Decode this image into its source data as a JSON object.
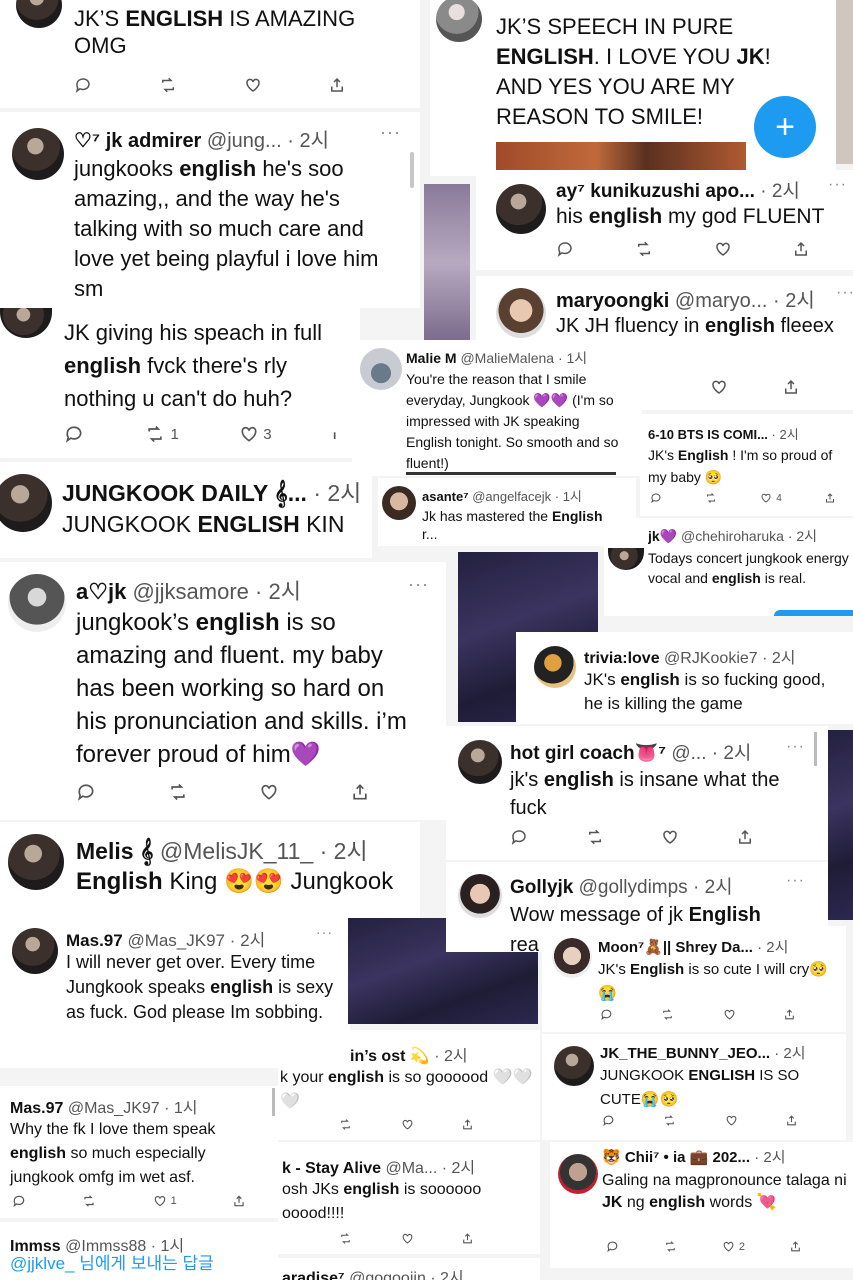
{
  "colors": {
    "accent": "#1d9bf0",
    "heart_purple": "#9b3de6",
    "text": "#111111",
    "muted": "#555555"
  },
  "tweets": [
    {
      "id": "t1",
      "text_pre": "JK’S ",
      "bold": "ENGLISH",
      "text_post": " IS AMAZING OMG"
    },
    {
      "id": "t2",
      "name": "♡⁷ jk admirer",
      "handle": "@jung... · 2시",
      "text_pre": "jungkooks ",
      "bold": "english",
      "text_post": " he's soo amazing,, and the way he's talking with so much care and love yet being playful i love him sm"
    },
    {
      "id": "t3",
      "text_pre": "JK giving his speach in full ",
      "bold": "english",
      "text_post": " fvck there's rly nothing u can't do huh?",
      "reply_count": "1",
      "like_count": "3"
    },
    {
      "id": "t4",
      "name": "JUNGKOOK DAILY 𝄞...",
      "handle": "· 2시",
      "text_pre": "JUNGKOOK ",
      "bold": "ENGLISH",
      "text_post": " KIN"
    },
    {
      "id": "t5",
      "name": "a♡jk",
      "handle": "@jjksamore · 2시",
      "text_pre": "jungkook’s ",
      "bold": "english",
      "text_post": " is so amazing and fluent. my baby has been working so hard on his pronunciation and skills. i’m forever proud of him💜"
    },
    {
      "id": "t6",
      "name": "Melis 𝄞",
      "handle": "@MelisJK_11_ · 2시",
      "text_pre": "",
      "bold": "English",
      "text_post": " King 😍😍 Jungkook"
    },
    {
      "id": "t7",
      "name": "Mas.97",
      "handle": "@Mas_JK97 · 2시",
      "text_pre": "I will never get over. Every time Jungkook speaks ",
      "bold": "english",
      "text_post": " is sexy as fuck. God please Im sobbing."
    },
    {
      "id": "t8",
      "name": "Mas.97",
      "handle": "@Mas_JK97 · 1시",
      "text_pre": "Why the fk I love them speak ",
      "bold": "english",
      "text_post": " so much especially jungkook omfg im wet asf.",
      "like_count": "1"
    },
    {
      "id": "t9",
      "name": "Immss",
      "handle": "@Immss88 · 1시",
      "reply_to": "@jjklve_ 님에게 보내는 답글"
    },
    {
      "id": "t10",
      "text_pre": "JK’S SPEECH IN PURE ",
      "bold": "ENGLISH",
      "text_mid": ". I LOVE YOU ",
      "bold2": "JK",
      "text_post": "! AND YES YOU ARE MY REASON TO SMILE!",
      "fab": "+"
    },
    {
      "id": "t11",
      "name": "ay⁷ kunikuzushi apo...",
      "handle": "· 2시",
      "text_pre": "his ",
      "bold": "english",
      "text_post": " my god FLUENT"
    },
    {
      "id": "t12",
      "name": "maryoongki",
      "handle": "@maryo... · 2시",
      "text_pre": "JK JH fluency in ",
      "bold": "english",
      "text_post": " fleeex"
    },
    {
      "id": "t13",
      "name": "Malie M",
      "handle": "@MalieMalena · 1시",
      "text": "You're the reason that I smile everyday, Jungkook 💜💜 (I'm so impressed with JK speaking English tonight. So smooth and so fluent!)"
    },
    {
      "id": "t14",
      "name": "asante⁷",
      "handle": "@angelfacejk · 1시",
      "text_pre": "Jk has mastered the ",
      "bold": "English",
      "text_post": " r..."
    },
    {
      "id": "t15",
      "name": "6-10 BTS IS COMI...",
      "handle": "· 2시",
      "text_pre": "JK's ",
      "bold": "English",
      "text_post": " ! I'm so proud of my baby 🥺",
      "like_count": "4"
    },
    {
      "id": "t16",
      "name": "jk💜",
      "handle": "@chehiroharuka · 2시",
      "text_pre": "Todays concert jungkook energy vocal and ",
      "bold": "english",
      "text_post": " is real."
    },
    {
      "id": "t17",
      "name": "trivia:love",
      "handle": "@RJKookie7 · 2시",
      "text_pre": "JK's ",
      "bold": "english",
      "text_post": " is so fucking good, he is killing the game"
    },
    {
      "id": "t18",
      "name": "hot girl coach👅⁷",
      "handle": "@... · 2시",
      "text_pre": "jk's ",
      "bold": "english",
      "text_post": " is insane what the fuck"
    },
    {
      "id": "t19",
      "name": "Gollyjk",
      "handle": "@gollydimps · 2시",
      "text_pre": "Wow message of jk ",
      "bold": "English",
      "text_post": " rea"
    },
    {
      "id": "t20",
      "name": "Moon⁷🧸|| Shrey Da...",
      "handle": "· 2시",
      "text_pre": "JK's ",
      "bold": "English",
      "text_post": " is so cute I will cry🥺😭"
    },
    {
      "id": "t21",
      "name": "in’s ost 💫",
      "handle": "· 2시",
      "text_pre": "k your ",
      "bold": "english",
      "text_post": " is so goooood 🤍🤍🤍"
    },
    {
      "id": "t22",
      "name": "JK_THE_BUNNY_JEO...",
      "handle": "· 2시",
      "text_pre": "JUNGKOOK ",
      "bold": "ENGLISH",
      "text_post": " IS SO CUTE😭🥺"
    },
    {
      "id": "t23",
      "name": "k - Stay Alive",
      "handle": "@Ma... · 2시",
      "text_pre": "osh JKs ",
      "bold": "english",
      "text_post": " is soooooo ooood!!!!"
    },
    {
      "id": "t24",
      "name": "🐯 Chii⁷ • ia 💼 202...",
      "handle": "· 2시",
      "text_pre": "Galing na magpronounce talaga ni ",
      "bold": "JK",
      "text_mid": " ng ",
      "bold2": "english",
      "text_post": " words 💘",
      "like_count": "2"
    },
    {
      "id": "t25",
      "name": "aradise⁷",
      "handle": "@gogoojin · 2시"
    }
  ]
}
